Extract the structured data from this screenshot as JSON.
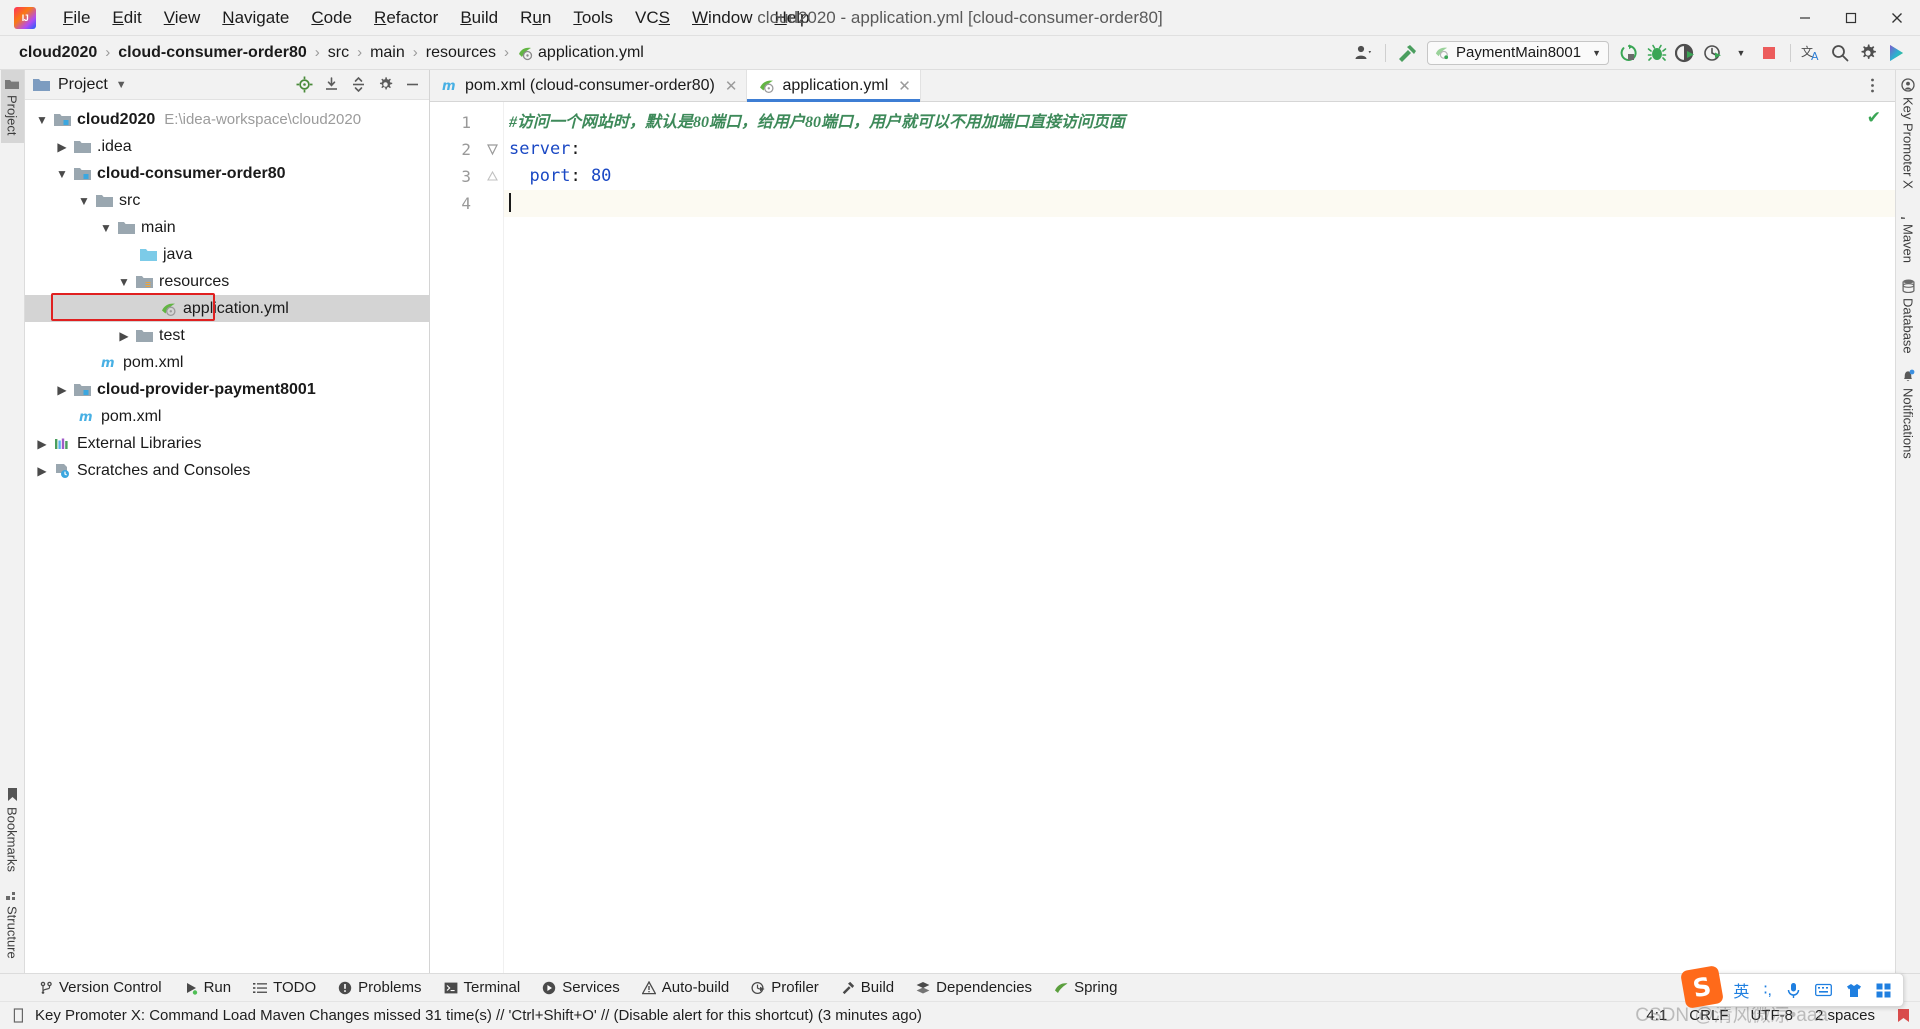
{
  "window": {
    "title": "cloud2020 - application.yml [cloud-consumer-order80]",
    "minimize_label": "─",
    "maximize_label": "❐",
    "close_label": "✕"
  },
  "menu": {
    "items": [
      {
        "label": "File"
      },
      {
        "label": "Edit"
      },
      {
        "label": "View"
      },
      {
        "label": "Navigate"
      },
      {
        "label": "Code"
      },
      {
        "label": "Refactor"
      },
      {
        "label": "Build"
      },
      {
        "label": "Run"
      },
      {
        "label": "Tools"
      },
      {
        "label": "VCS"
      },
      {
        "label": "Window"
      },
      {
        "label": "Help"
      }
    ]
  },
  "breadcrumb": {
    "items": [
      {
        "label": "cloud2020",
        "bold": true
      },
      {
        "label": "cloud-consumer-order80",
        "bold": true
      },
      {
        "label": "src",
        "bold": false
      },
      {
        "label": "main",
        "bold": false
      },
      {
        "label": "resources",
        "bold": false
      },
      {
        "label": "application.yml",
        "bold": false,
        "icon": "yml-icon"
      }
    ],
    "separator": "›"
  },
  "toolbar": {
    "run_config": "PaymentMain8001",
    "icons": [
      {
        "name": "user-icon",
        "title": "Switch user"
      },
      {
        "name": "hammer-build-icon",
        "title": "Build"
      },
      {
        "name": "run-icon",
        "title": "Run"
      },
      {
        "name": "debug-icon",
        "title": "Debug"
      },
      {
        "name": "run-coverage-icon",
        "title": "Run with Coverage"
      },
      {
        "name": "profiler-icon",
        "title": "Profile"
      },
      {
        "name": "stop-icon",
        "title": "Stop"
      },
      {
        "name": "translate-icon",
        "title": "Translate"
      },
      {
        "name": "search-icon",
        "title": "Search Everywhere"
      },
      {
        "name": "settings-gear-icon",
        "title": "Settings"
      },
      {
        "name": "updates-icon",
        "title": "Updates"
      }
    ]
  },
  "left_stripe": {
    "top": [
      {
        "label": "Project",
        "active": true,
        "icon": "project-folder-icon"
      }
    ],
    "bottom": [
      {
        "label": "Structure",
        "icon": "structure-icon"
      },
      {
        "label": "Bookmarks",
        "icon": "bookmark-icon"
      }
    ]
  },
  "right_stripe": {
    "items": [
      {
        "label": "Key Promoter X",
        "icon": "key-promoter-icon"
      },
      {
        "label": "Maven",
        "icon": "maven-icon"
      },
      {
        "label": "Database",
        "icon": "database-icon"
      },
      {
        "label": "Notifications",
        "icon": "notifications-bell-icon"
      }
    ]
  },
  "project_panel": {
    "title": "Project",
    "header_icons": [
      {
        "name": "locate-target-icon"
      },
      {
        "name": "collapse-to-icon"
      },
      {
        "name": "expand-collapse-icon"
      },
      {
        "name": "settings-gear-icon"
      },
      {
        "name": "hide-panel-icon"
      }
    ],
    "tree": [
      {
        "indent": 0,
        "arrow": "down",
        "icon": "module-folder-icon",
        "label": "cloud2020",
        "bold": true,
        "path": "E:\\idea-workspace\\cloud2020"
      },
      {
        "indent": 1,
        "arrow": "right",
        "icon": "folder-icon",
        "label": ".idea",
        "bold": false,
        "path": ""
      },
      {
        "indent": 1,
        "arrow": "down",
        "icon": "module-folder-icon",
        "label": "cloud-consumer-order80",
        "bold": true,
        "path": ""
      },
      {
        "indent": 2,
        "arrow": "down",
        "icon": "folder-icon",
        "label": "src",
        "bold": false,
        "path": ""
      },
      {
        "indent": 3,
        "arrow": "down",
        "icon": "folder-icon",
        "label": "main",
        "bold": false,
        "path": ""
      },
      {
        "indent": 4,
        "arrow": "none",
        "icon": "source-folder-icon",
        "label": "java",
        "bold": false,
        "path": ""
      },
      {
        "indent": 4,
        "arrow": "down",
        "icon": "resources-folder-icon",
        "label": "resources",
        "bold": false,
        "path": ""
      },
      {
        "indent": 5,
        "arrow": "none",
        "icon": "yml-icon",
        "label": "application.yml",
        "bold": false,
        "path": "",
        "selected": true,
        "highlighted": true
      },
      {
        "indent": 4,
        "arrow": "right",
        "icon": "folder-icon",
        "label": "test",
        "bold": false,
        "path": ""
      },
      {
        "indent": 3,
        "arrow": "none",
        "icon": "maven-m-icon",
        "label": "pom.xml",
        "bold": false,
        "path": ""
      },
      {
        "indent": 1,
        "arrow": "right",
        "icon": "module-folder-icon",
        "label": "cloud-provider-payment8001",
        "bold": true,
        "path": ""
      },
      {
        "indent": 1,
        "arrow": "none",
        "icon": "maven-m-icon",
        "label": "pom.xml",
        "bold": false,
        "path": ""
      },
      {
        "indent": 0,
        "arrow": "right",
        "icon": "external-libraries-icon",
        "label": "External Libraries",
        "bold": false,
        "path": ""
      },
      {
        "indent": 0,
        "arrow": "right",
        "icon": "scratches-icon",
        "label": "Scratches and Consoles",
        "bold": false,
        "path": ""
      }
    ]
  },
  "editor": {
    "tabs": [
      {
        "label": "pom.xml (cloud-consumer-order80)",
        "icon": "maven-m-icon",
        "active": false,
        "close": "✕"
      },
      {
        "label": "application.yml",
        "icon": "yml-icon",
        "active": true,
        "close": "✕"
      }
    ],
    "line_numbers": [
      "1",
      "2",
      "3",
      "4"
    ],
    "lines": [
      {
        "n": 1,
        "type": "comment",
        "text": "#访问一个网站时，默认是80端口，给用户80端口，用户就可以不用加端口直接访问页面"
      },
      {
        "n": 2,
        "type": "key",
        "key": "server",
        "punc": ":",
        "indent": 0,
        "fold": true
      },
      {
        "n": 3,
        "type": "keyval",
        "key": "port",
        "punc": ":",
        "value": "80",
        "indent": 2,
        "fold": true
      },
      {
        "n": 4,
        "type": "empty",
        "text": "",
        "caret": true
      }
    ],
    "inspection_status": "✔"
  },
  "tool_windows": [
    {
      "label": "Version Control",
      "icon": "vcs-branch-icon"
    },
    {
      "label": "Run",
      "icon": "run-icon"
    },
    {
      "label": "TODO",
      "icon": "todo-list-icon"
    },
    {
      "label": "Problems",
      "icon": "problems-icon"
    },
    {
      "label": "Terminal",
      "icon": "terminal-icon"
    },
    {
      "label": "Services",
      "icon": "services-icon"
    },
    {
      "label": "Auto-build",
      "icon": "warning-triangle-icon"
    },
    {
      "label": "Profiler",
      "icon": "profiler-icon"
    },
    {
      "label": "Build",
      "icon": "hammer-build-icon"
    },
    {
      "label": "Dependencies",
      "icon": "dependencies-icon"
    },
    {
      "label": "Spring",
      "icon": "spring-leaf-icon"
    }
  ],
  "statusbar": {
    "message": "Key Promoter X: Command Load Maven Changes missed 31 time(s) // 'Ctrl+Shift+O' // (Disable alert for this shortcut) (3 minutes ago)",
    "caret_position": "4:1",
    "line_separator": "CRLF",
    "encoding": "UTF-8",
    "indent": "2 spaces",
    "lock_icon": "read-only-lock-icon"
  },
  "ime": {
    "logo": "S",
    "items": [
      "英",
      "∶,",
      "🎤",
      "⌨",
      "👕",
      "▒"
    ]
  },
  "watermark": "CSDN @清风微凉•aaa",
  "colors": {
    "accent_blue": "#3e7ed4",
    "highlight_red": "#e02020",
    "comment_green": "#3e8a5a",
    "keyword_blue": "#1a48c4",
    "selection_gray": "#d4d4d4",
    "chrome_bg": "#f2f2f2"
  }
}
